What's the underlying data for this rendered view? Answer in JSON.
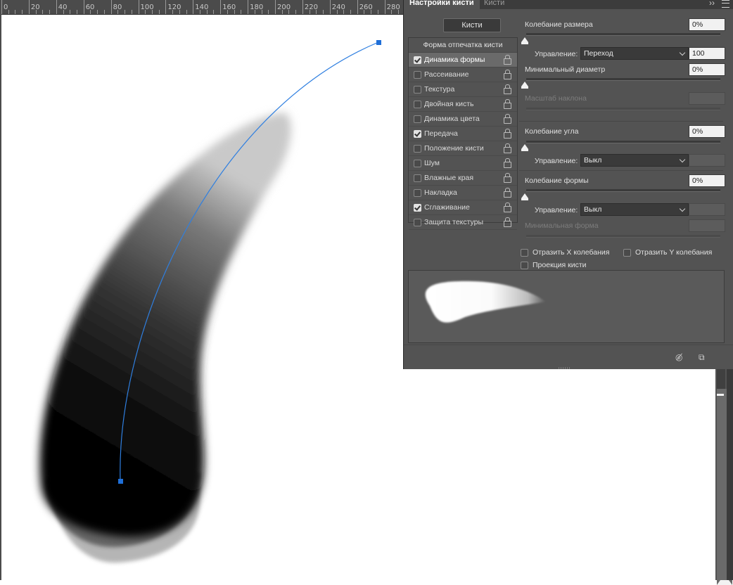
{
  "ruler": {
    "labels": [
      "0",
      "20",
      "40",
      "60",
      "80",
      "100",
      "120",
      "140",
      "160",
      "180",
      "200",
      "220",
      "240",
      "260",
      "280"
    ]
  },
  "panel": {
    "tabs": [
      {
        "label": "Настройки кисти",
        "active": true
      },
      {
        "label": "Кисти",
        "active": false
      }
    ],
    "expand_icon": "double-chevron-right-icon",
    "menu_icon": "panel-menu-icon",
    "brushes_button": "Кисти",
    "options_header": "Форма отпечатка кисти",
    "options": [
      {
        "label": "Динамика формы",
        "checked": true,
        "selected": true
      },
      {
        "label": "Рассеивание",
        "checked": false
      },
      {
        "label": "Текстура",
        "checked": false
      },
      {
        "label": "Двойная кисть",
        "checked": false
      },
      {
        "label": "Динамика цвета",
        "checked": false
      },
      {
        "label": "Передача",
        "checked": true
      },
      {
        "label": "Положение кисти",
        "checked": false
      },
      {
        "label": "Шум",
        "checked": false
      },
      {
        "label": "Влажные края",
        "checked": false
      },
      {
        "label": "Накладка",
        "checked": false
      },
      {
        "label": "Сглаживание",
        "checked": true
      },
      {
        "label": "Защита текстуры",
        "checked": false
      }
    ],
    "settings": {
      "size_jitter": {
        "label": "Колебание размера",
        "value": "0%"
      },
      "size_control": {
        "label": "Управление:",
        "selected": "Переход",
        "value": "100"
      },
      "min_diameter": {
        "label": "Минимальный диаметр",
        "value": "0%"
      },
      "tilt_scale": {
        "label": "Масштаб наклона",
        "value": ""
      },
      "angle_jitter": {
        "label": "Колебание угла",
        "value": "0%"
      },
      "angle_control": {
        "label": "Управление:",
        "selected": "Выкл"
      },
      "roundness_jitter": {
        "label": "Колебание формы",
        "value": "0%"
      },
      "roundness_control": {
        "label": "Управление:",
        "selected": "Выкл"
      },
      "min_roundness": {
        "label": "Минимальная форма",
        "value": ""
      }
    },
    "checkboxes": {
      "flip_x": {
        "label": "Отразить X колебания",
        "checked": false
      },
      "flip_y": {
        "label": "Отразить Y колебания",
        "checked": false
      },
      "projection": {
        "label": "Проекция кисти",
        "checked": false
      }
    },
    "footer_icons": [
      "eye-brush-icon",
      "new-preset-icon"
    ]
  },
  "colors": {
    "path": "#2f7fe0",
    "anchor": "#1f6fd8",
    "panel_bg": "#535353"
  }
}
